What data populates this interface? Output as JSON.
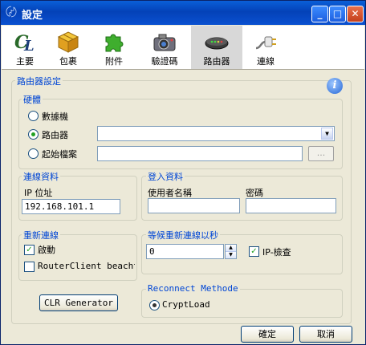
{
  "window": {
    "title": "設定"
  },
  "toolbar": {
    "items": [
      {
        "label": "主要",
        "icon": "cl-logo-icon"
      },
      {
        "label": "包裹",
        "icon": "package-icon"
      },
      {
        "label": "附件",
        "icon": "puzzle-icon"
      },
      {
        "label": "驗證碼",
        "icon": "camera-icon"
      },
      {
        "label": "路由器",
        "icon": "router-icon",
        "active": true
      },
      {
        "label": "連線",
        "icon": "plug-icon"
      }
    ]
  },
  "router_settings": {
    "title": "路由器設定",
    "hardware": {
      "title": "硬體",
      "option_modem": "數據機",
      "option_router": "路由器",
      "option_script": "起始檔案",
      "selected": "router",
      "router_select_value": "",
      "script_value": "",
      "browse_label": "..."
    },
    "connection_info": {
      "title": "連線資料",
      "ip_label": "IP 位址",
      "ip_value": "192.168.101.1"
    },
    "login_info": {
      "title": "登入資料",
      "username_label": "使用者名稱",
      "username_value": "",
      "password_label": "密碼",
      "password_value": ""
    },
    "reconnect": {
      "title": "重新連線",
      "enable_label": "啟動",
      "enable_checked": true,
      "routerclient_label": "RouterClient beachten",
      "routerclient_checked": false
    },
    "wait": {
      "title": "等候重新連線以秒",
      "seconds_value": "0",
      "ip_check_label": "IP-檢查",
      "ip_check_checked": true
    },
    "reconnect_method": {
      "title": "Reconnect Methode",
      "option": "CryptLoad",
      "selected": true
    },
    "clr_button": "CLR Generator"
  },
  "footer": {
    "ok_label": "確定",
    "cancel_label": "取消"
  }
}
